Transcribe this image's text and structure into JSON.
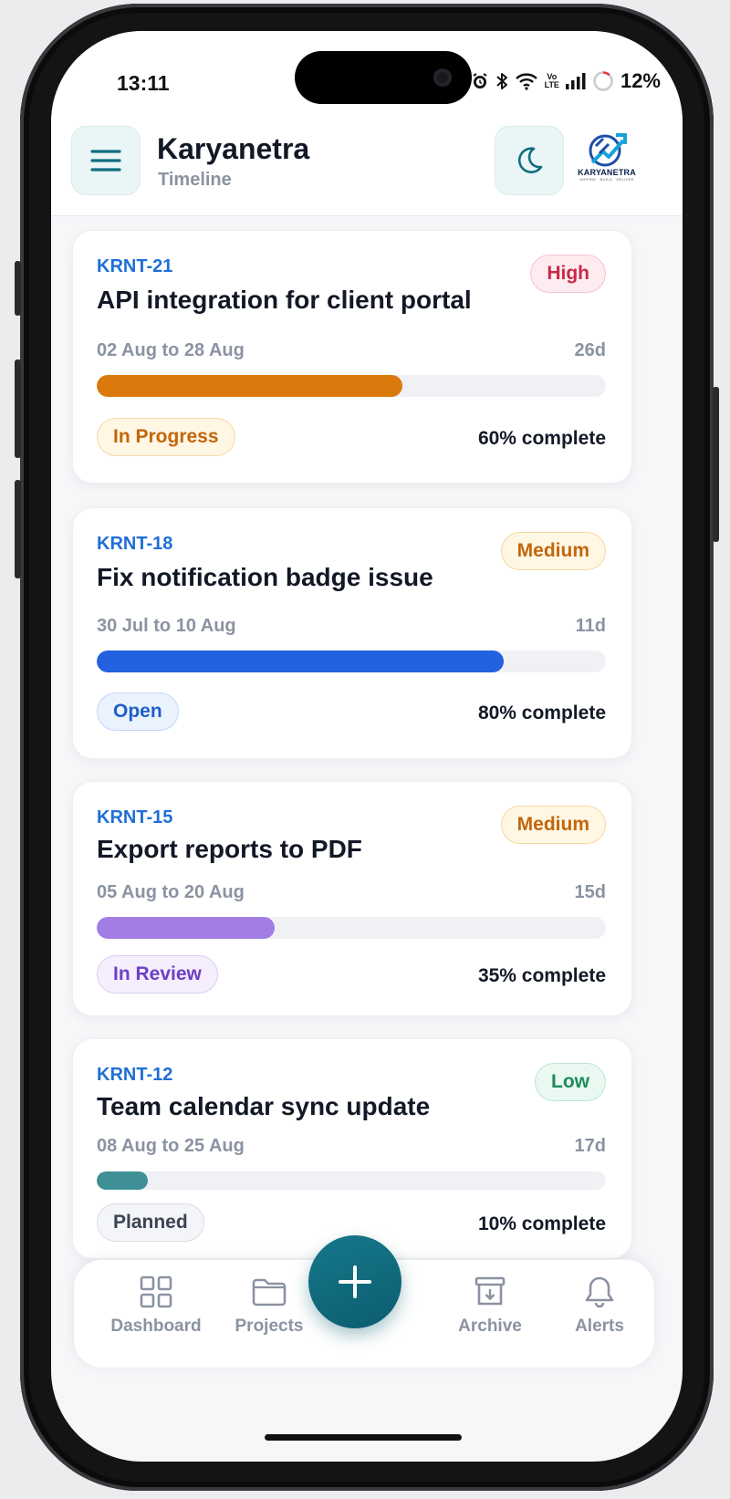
{
  "status": {
    "time": "13:11",
    "volte_top": "Vo",
    "volte_bottom": "LTE",
    "battery": "12%"
  },
  "header": {
    "title": "Karyanetra",
    "subtitle": "Timeline",
    "logo_name": "KARYANETRA",
    "logo_tagline": "INSPIRE · BUILD · DELIVER"
  },
  "tasks": [
    {
      "id": "KRNT-21",
      "title": "API integration for client portal",
      "dates": "02 Aug to 28 Aug",
      "duration": "26d",
      "priority": "High",
      "status": "In Progress",
      "progress": 0.6,
      "complete_label": "60% complete",
      "bar_color": "#db7a0c"
    },
    {
      "id": "KRNT-18",
      "title": "Fix notification badge issue",
      "dates": "30 Jul to 10 Aug",
      "duration": "11d",
      "priority": "Medium",
      "status": "Open",
      "progress": 0.8,
      "complete_label": "80% complete",
      "bar_color": "#2261e0"
    },
    {
      "id": "KRNT-15",
      "title": "Export reports to PDF",
      "dates": "05 Aug to 20 Aug",
      "duration": "15d",
      "priority": "Medium",
      "status": "In Review",
      "progress": 0.35,
      "complete_label": "35% complete",
      "bar_color": "#a27de3"
    },
    {
      "id": "KRNT-12",
      "title": "Team calendar sync update",
      "dates": "08 Aug to 25 Aug",
      "duration": "17d",
      "priority": "Low",
      "status": "Planned",
      "progress": 0.1,
      "complete_label": "10% complete",
      "bar_color": "#3e8f96"
    }
  ],
  "priority_colors": {
    "High": {
      "text": "#c8284a",
      "bg": "#fdecef",
      "border": "#f6c3cd"
    },
    "Medium": {
      "text": "#c2660a",
      "bg": "#fff6e4",
      "border": "#f5d9a3"
    },
    "Low": {
      "text": "#1f8a5a",
      "bg": "#e9f8f0",
      "border": "#bfe6d1"
    }
  },
  "status_colors": {
    "In Progress": {
      "text": "#c2660a",
      "bg": "#fff6e4",
      "border": "#f5d9a3"
    },
    "Open": {
      "text": "#1f5fc9",
      "bg": "#eaf2fe",
      "border": "#c4d8f6"
    },
    "In Review": {
      "text": "#6f3fc4",
      "bg": "#f4eefd",
      "border": "#dccdf4"
    },
    "Planned": {
      "text": "#3b4454",
      "bg": "#f4f5f8",
      "border": "#d9dde4"
    }
  },
  "nav": {
    "dashboard": "Dashboard",
    "projects": "Projects",
    "archive": "Archive",
    "alerts": "Alerts"
  },
  "accent": "#0f6e80"
}
